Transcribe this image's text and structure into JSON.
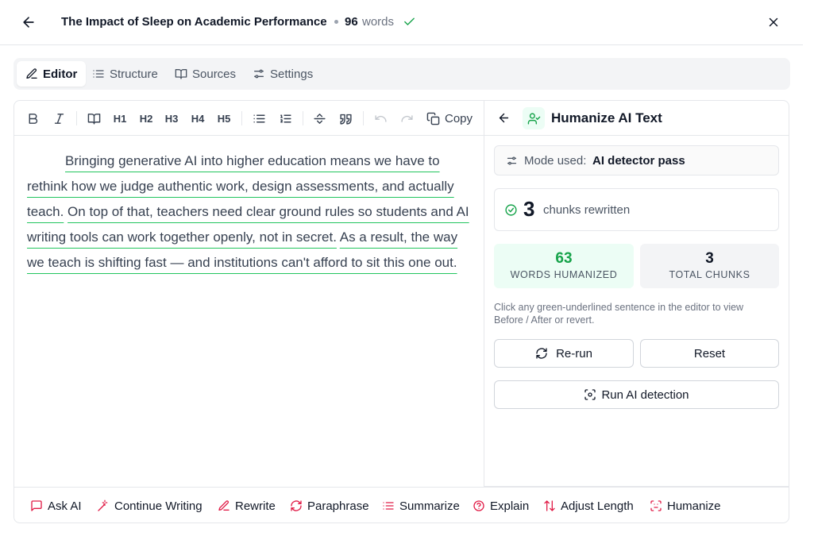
{
  "header": {
    "title": "The Impact of Sleep on Academic Performance",
    "word_count": "96",
    "word_label": "words"
  },
  "tabs": [
    {
      "label": "Editor",
      "icon": "pencil-icon",
      "active": true
    },
    {
      "label": "Structure",
      "icon": "list-icon",
      "active": false
    },
    {
      "label": "Sources",
      "icon": "book-icon",
      "active": false
    },
    {
      "label": "Settings",
      "icon": "sliders-icon",
      "active": false
    }
  ],
  "toolbar": {
    "h1": "H1",
    "h2": "H2",
    "h3": "H3",
    "h4": "H4",
    "h5": "H5",
    "copy_label": "Copy"
  },
  "editor": {
    "sentences": [
      "Bringing generative AI into higher education means we have to rethink how we judge authentic work, design assessments, and actually teach.",
      "On top of that, teachers need clear ground rules so students and AI writing tools can work together openly, not in secret.",
      "As a result, the way we teach is shifting fast — and institutions can't afford to sit this one out."
    ]
  },
  "panel": {
    "title": "Humanize AI Text",
    "mode_label": "Mode used:",
    "mode_value": "AI detector pass",
    "chunks_num": "3",
    "chunks_label": "chunks rewritten",
    "words_humanized": "63",
    "words_humanized_label": "WORDS HUMANIZED",
    "total_chunks": "3",
    "total_chunks_label": "TOTAL CHUNKS",
    "hint": "Click any green-underlined sentence in the editor to view Before / After or revert.",
    "rerun_label": "Re-run",
    "reset_label": "Reset",
    "detect_label": "Run AI detection"
  },
  "ai_bar": [
    {
      "label": "Ask AI",
      "icon": "message-icon"
    },
    {
      "label": "Continue Writing",
      "icon": "magic-wand-icon"
    },
    {
      "label": "Rewrite",
      "icon": "pen-icon"
    },
    {
      "label": "Paraphrase",
      "icon": "refresh-icon"
    },
    {
      "label": "Summarize",
      "icon": "list-lines-icon"
    },
    {
      "label": "Explain",
      "icon": "help-circle-icon"
    },
    {
      "label": "Adjust Length",
      "icon": "arrows-updown-icon"
    },
    {
      "label": "Humanize",
      "icon": "scan-face-icon"
    }
  ],
  "colors": {
    "accent_green": "#16a34a",
    "underline_green": "#22c55e",
    "ai_icon_red": "#e11d48"
  }
}
